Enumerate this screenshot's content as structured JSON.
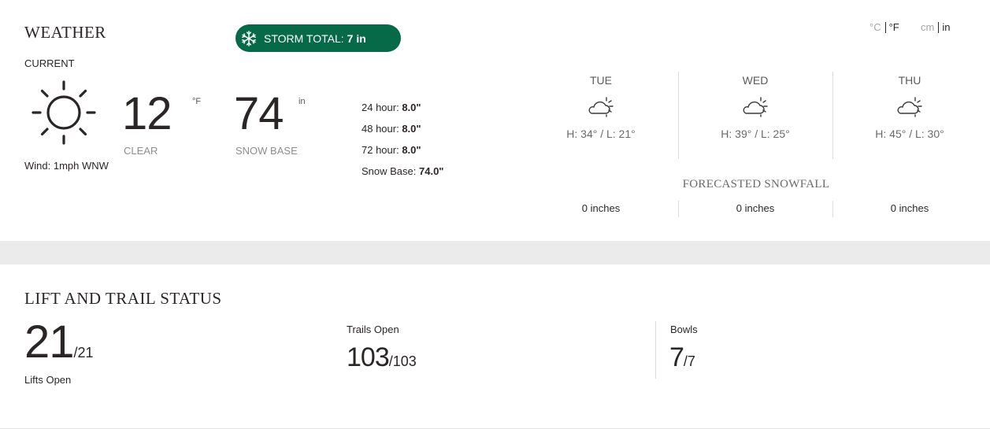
{
  "weather": {
    "title": "WEATHER",
    "storm_total": {
      "label": "STORM TOTAL:",
      "value": "7 in",
      "icon": "snowflake-icon",
      "color": "#066a48"
    },
    "units": {
      "temp": {
        "celsius": "°C",
        "fahrenheit": "°F",
        "selected": "°F"
      },
      "length": {
        "cm": "cm",
        "in": "in",
        "selected": "in"
      }
    },
    "current": {
      "label": "CURRENT",
      "icon": "sun-icon",
      "temperature": "12",
      "temperature_unit": "°F",
      "condition": "CLEAR",
      "snow_base": "74",
      "snow_base_unit": "in",
      "snow_base_label": "SNOW BASE",
      "wind": "Wind: 1mph WNW"
    },
    "snowfall_history": [
      {
        "label": "24 hour:",
        "value": "8.0\""
      },
      {
        "label": "48 hour:",
        "value": "8.0\""
      },
      {
        "label": "72 hour:",
        "value": "8.0\""
      },
      {
        "label": "Snow Base:",
        "value": "74.0\""
      }
    ],
    "forecast": [
      {
        "day": "TUE",
        "icon": "partly-cloudy-icon",
        "high_low": "H: 34° / L: 21°",
        "snowfall": "0 inches"
      },
      {
        "day": "WED",
        "icon": "partly-cloudy-icon",
        "high_low": "H: 39° / L: 25°",
        "snowfall": "0 inches"
      },
      {
        "day": "THU",
        "icon": "partly-cloudy-icon",
        "high_low": "H: 45° / L: 30°",
        "snowfall": "0 inches"
      }
    ],
    "forecasted_snowfall_title": "FORECASTED SNOWFALL"
  },
  "lift_status": {
    "title": "LIFT AND TRAIL STATUS",
    "lifts": {
      "open": "21",
      "total": "/21",
      "label": "Lifts Open"
    },
    "trails": {
      "open": "103",
      "total": "/103",
      "label": "Trails Open"
    },
    "bowls": {
      "open": "7",
      "total": "/7",
      "label": "Bowls"
    }
  }
}
